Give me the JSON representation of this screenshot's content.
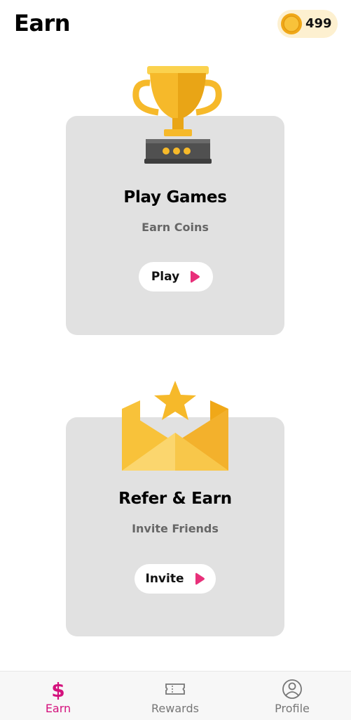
{
  "header": {
    "title": "Earn",
    "coins": "499"
  },
  "cards": [
    {
      "title": "Play Games",
      "subtitle": "Earn Coins",
      "button_label": "Play"
    },
    {
      "title": "Refer & Earn",
      "subtitle": "Invite Friends",
      "button_label": "Invite"
    }
  ],
  "bottom_nav": {
    "items": [
      {
        "label": "Earn",
        "icon": "dollar-icon",
        "active": true
      },
      {
        "label": "Rewards",
        "icon": "ticket-icon",
        "active": false
      },
      {
        "label": "Profile",
        "icon": "profile-icon",
        "active": false
      }
    ]
  },
  "colors": {
    "accent": "#d4127d",
    "card_bg": "#e1e1e1",
    "gold": "#f6b92a"
  }
}
